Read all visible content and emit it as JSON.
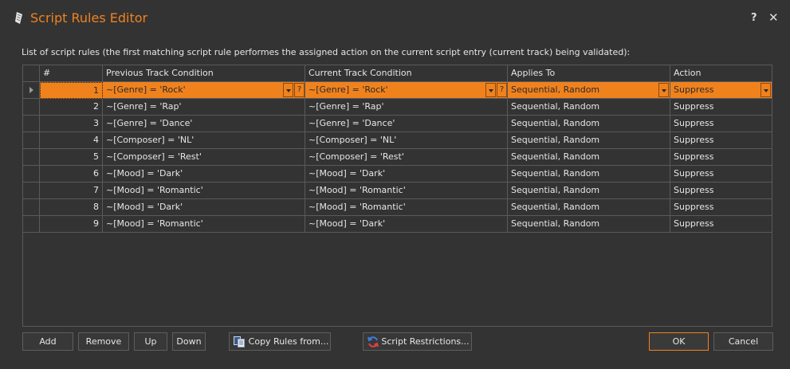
{
  "window": {
    "title": "Script Rules Editor",
    "help_label": "?",
    "close_label": "✕"
  },
  "description": "List of script rules (the first matching script rule performes the assigned action on the current script entry (current track) being validated):",
  "grid": {
    "columns": [
      "#",
      "Previous Track Condition",
      "Current Track Condition",
      "Applies To",
      "Action"
    ],
    "selected_row": 0,
    "rows": [
      {
        "num": "1",
        "prev": "~[Genre] = 'Rock'",
        "cur": "~[Genre] = 'Rock'",
        "applies": "Sequential, Random",
        "action": "Suppress"
      },
      {
        "num": "2",
        "prev": "~[Genre] = 'Rap'",
        "cur": "~[Genre] = 'Rap'",
        "applies": "Sequential, Random",
        "action": "Suppress"
      },
      {
        "num": "3",
        "prev": "~[Genre] = 'Dance'",
        "cur": "~[Genre] = 'Dance'",
        "applies": "Sequential, Random",
        "action": "Suppress"
      },
      {
        "num": "4",
        "prev": "~[Composer] = 'NL'",
        "cur": "~[Composer] = 'NL'",
        "applies": "Sequential, Random",
        "action": "Suppress"
      },
      {
        "num": "5",
        "prev": "~[Composer] = 'Rest'",
        "cur": "~[Composer] = 'Rest'",
        "applies": "Sequential, Random",
        "action": "Suppress"
      },
      {
        "num": "6",
        "prev": "~[Mood] = 'Dark'",
        "cur": "~[Mood] = 'Dark'",
        "applies": "Sequential, Random",
        "action": "Suppress"
      },
      {
        "num": "7",
        "prev": "~[Mood] = 'Romantic'",
        "cur": "~[Mood] = 'Romantic'",
        "applies": "Sequential, Random",
        "action": "Suppress"
      },
      {
        "num": "8",
        "prev": "~[Mood] = 'Dark'",
        "cur": "~[Mood] = 'Romantic'",
        "applies": "Sequential, Random",
        "action": "Suppress"
      },
      {
        "num": "9",
        "prev": "~[Mood] = 'Romantic'",
        "cur": "~[Mood] = 'Dark'",
        "applies": "Sequential, Random",
        "action": "Suppress"
      }
    ],
    "edit_help_label": "?"
  },
  "buttons": {
    "add": "Add",
    "remove": "Remove",
    "up": "Up",
    "down": "Down",
    "copy_rules": "Copy Rules from...",
    "script_restrictions": "Script Restrictions...",
    "ok": "OK",
    "cancel": "Cancel"
  },
  "colors": {
    "accent": "#f0821e",
    "background": "#333333",
    "grid_line": "#5a5a5a"
  },
  "icons": {
    "app": "script-icon",
    "copy": "copy-icon",
    "restrictions": "refresh-icon"
  }
}
